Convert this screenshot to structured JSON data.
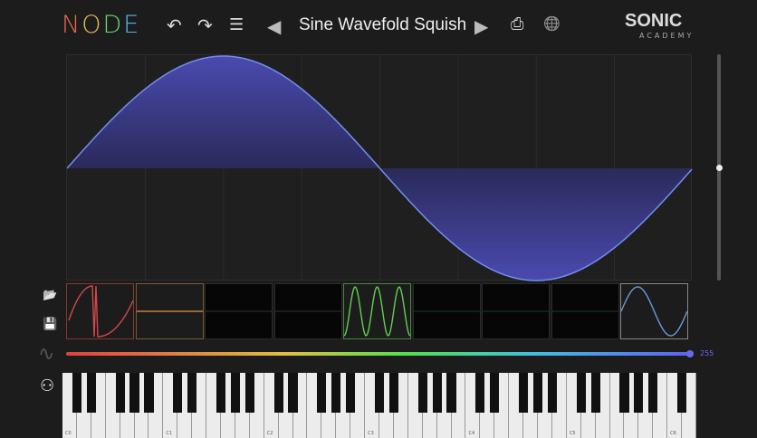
{
  "header": {
    "logo": [
      "N",
      "O",
      "D",
      "E"
    ],
    "logo_colors": [
      "#e86a4a",
      "#e8c050",
      "#6ad870",
      "#50b8e8"
    ],
    "preset_name": "Sine Wavefold Squish",
    "brand": "SONIC",
    "brand_sub": "ACADEMY"
  },
  "icons": {
    "undo": "↶",
    "redo": "↷",
    "list": "☰",
    "prev": "◀",
    "next": "▶",
    "export": "⎙",
    "globe": "🌐",
    "load": "📂",
    "save": "💾",
    "lfo": "∿",
    "midi": "⚇"
  },
  "colors": {
    "wave_stroke": "#6a8ae8",
    "wave_fill": "#3a3a8a",
    "accent": "#6a6af0"
  },
  "slots": [
    {
      "color": "#d04848",
      "type": "folded"
    },
    {
      "color": "#c08040",
      "type": "flat"
    },
    {
      "color": "#333",
      "type": "empty"
    },
    {
      "color": "#333",
      "type": "empty"
    },
    {
      "color": "#60d050",
      "type": "sine3"
    },
    {
      "color": "#1f3a30",
      "type": "empty"
    },
    {
      "color": "#1f3a30",
      "type": "empty"
    },
    {
      "color": "#1f3a30",
      "type": "empty"
    },
    {
      "color": "#6a9ae0",
      "type": "sine1",
      "selected": true
    }
  ],
  "slider": {
    "value": "255",
    "fraction": 1.0
  },
  "vertical_slider": {
    "fraction": 0.5
  },
  "keyboard": {
    "octave_labels": [
      "C0",
      "C1",
      "C2",
      "C3",
      "C4",
      "C5",
      "C6"
    ],
    "white_keys": 44
  }
}
